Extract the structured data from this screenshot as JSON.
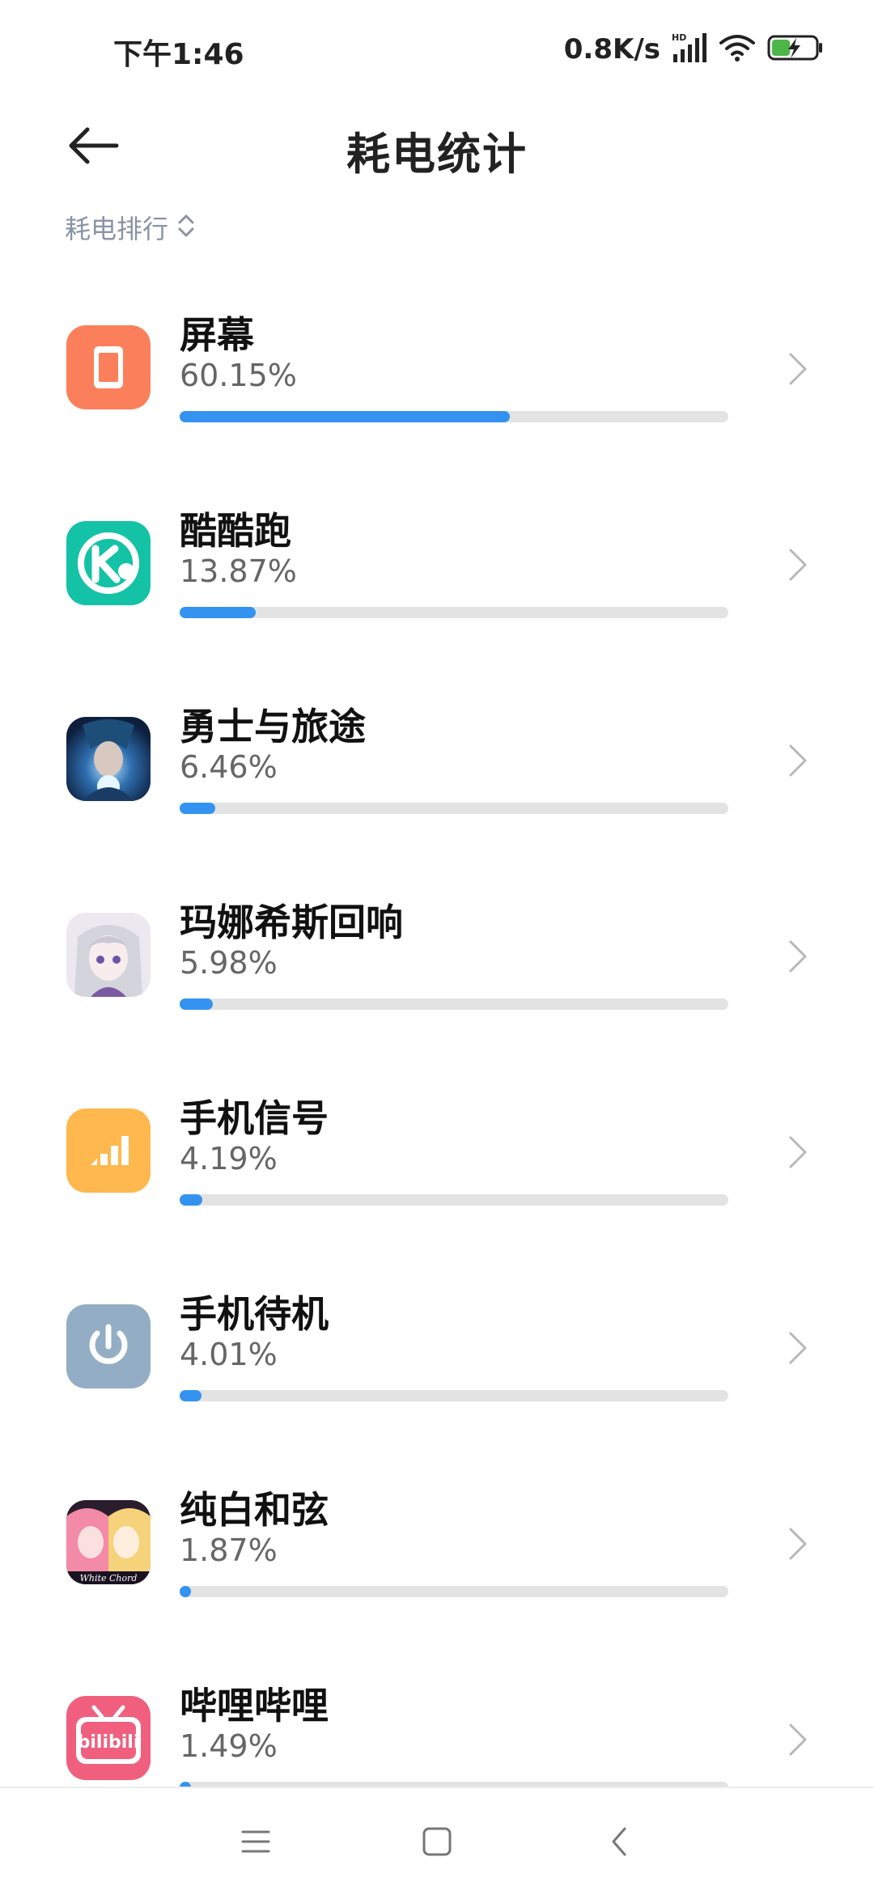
{
  "status_bar": {
    "time": "下午1:46",
    "net_speed": "0.8K/s",
    "signal_badge": "HD"
  },
  "header": {
    "title": "耗电统计"
  },
  "sort": {
    "label": "耗电排行"
  },
  "colors": {
    "bar_fill": "#3493f0",
    "bar_track": "#e3e3e3"
  },
  "apps": [
    {
      "name": "屏幕",
      "percent": "60.15%",
      "value": 60.15,
      "icon": "screen-icon"
    },
    {
      "name": "酷酷跑",
      "percent": "13.87%",
      "value": 13.87,
      "icon": "kukupao-app-icon"
    },
    {
      "name": "勇士与旅途",
      "percent": "6.46%",
      "value": 6.46,
      "icon": "warrior-journey-app-icon"
    },
    {
      "name": "玛娜希斯回响",
      "percent": "5.98%",
      "value": 5.98,
      "icon": "manahis-echo-app-icon"
    },
    {
      "name": "手机信号",
      "percent": "4.19%",
      "value": 4.19,
      "icon": "cell-signal-icon"
    },
    {
      "name": "手机待机",
      "percent": "4.01%",
      "value": 4.01,
      "icon": "power-icon"
    },
    {
      "name": "纯白和弦",
      "percent": "1.87%",
      "value": 1.87,
      "icon": "white-chord-app-icon"
    },
    {
      "name": "哔哩哔哩",
      "percent": "1.49%",
      "value": 1.49,
      "icon": "bilibili-app-icon"
    }
  ],
  "bilibili_logo_text": "bilibili",
  "white_chord_logo_text": "White Chord"
}
